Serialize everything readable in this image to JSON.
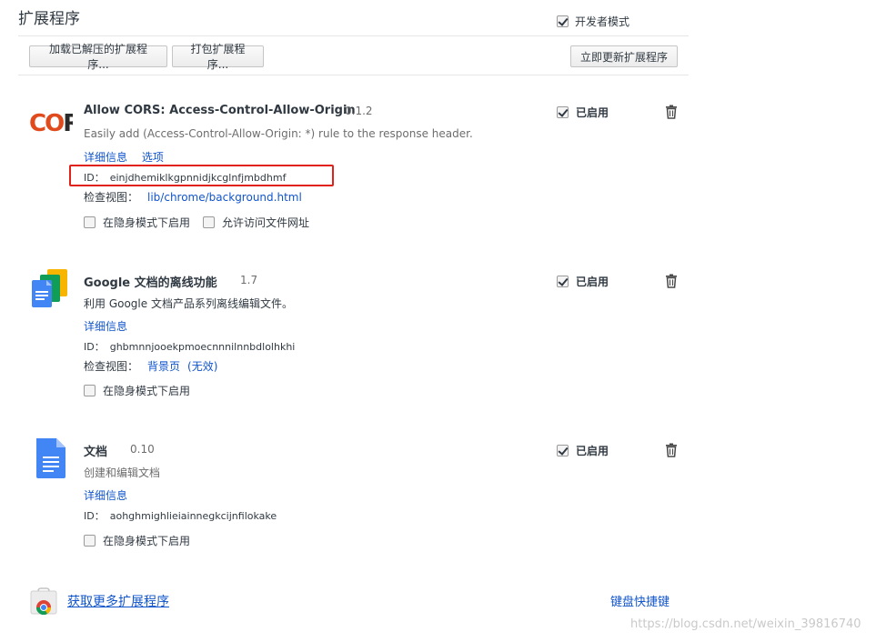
{
  "page": {
    "title": "扩展程序"
  },
  "devmode": {
    "label": "开发者模式",
    "checked": true
  },
  "toolbar": {
    "load_unpacked": "加载已解压的扩展程序...",
    "pack": "打包扩展程序...",
    "update_now": "立即更新扩展程序"
  },
  "extensions": [
    {
      "name": "Allow CORS: Access-Control-Allow-Origin",
      "version": "0.1.2",
      "description": "Easily add (Access-Control-Allow-Origin: *) rule to the response header.",
      "links": [
        "详细信息",
        "选项"
      ],
      "id_label": "ID：",
      "id": "einjdhemiklkgpnnidjkcglnfjmbdhmf",
      "views_label": "检查视图：",
      "views": [
        "lib/chrome/background.html"
      ],
      "options": [
        "在隐身模式下启用",
        "允许访问文件网址"
      ],
      "enabled_label": "已启用",
      "icon": "cors-logo-icon"
    },
    {
      "name": "Google 文档的离线功能",
      "version": "1.7",
      "description": "利用 Google 文档产品系列离线编辑文件。",
      "links": [
        "详细信息"
      ],
      "id_label": "ID：",
      "id": "ghbmnnjooekpmoecnnnilnnbdlolhkhi",
      "views_label": "检查视图：",
      "views": [
        "背景页",
        "(无效)"
      ],
      "options": [
        "在隐身模式下启用"
      ],
      "enabled_label": "已启用",
      "icon": "google-docs-offline-icon"
    },
    {
      "name": "文档",
      "version": "0.10",
      "description": "创建和编辑文档",
      "links": [
        "详细信息"
      ],
      "id_label": "ID：",
      "id": "aohghmighlieiainnegkcijnfilokake",
      "options": [
        "在隐身模式下启用"
      ],
      "enabled_label": "已启用",
      "icon": "google-docs-icon"
    }
  ],
  "footer": {
    "get_more": "获取更多扩展程序",
    "shortcuts": "键盘快捷键"
  },
  "watermark": "https://blog.csdn.net/weixin_39816740",
  "colors": {
    "link": "#1155cc",
    "highlight": "#e0221b"
  }
}
